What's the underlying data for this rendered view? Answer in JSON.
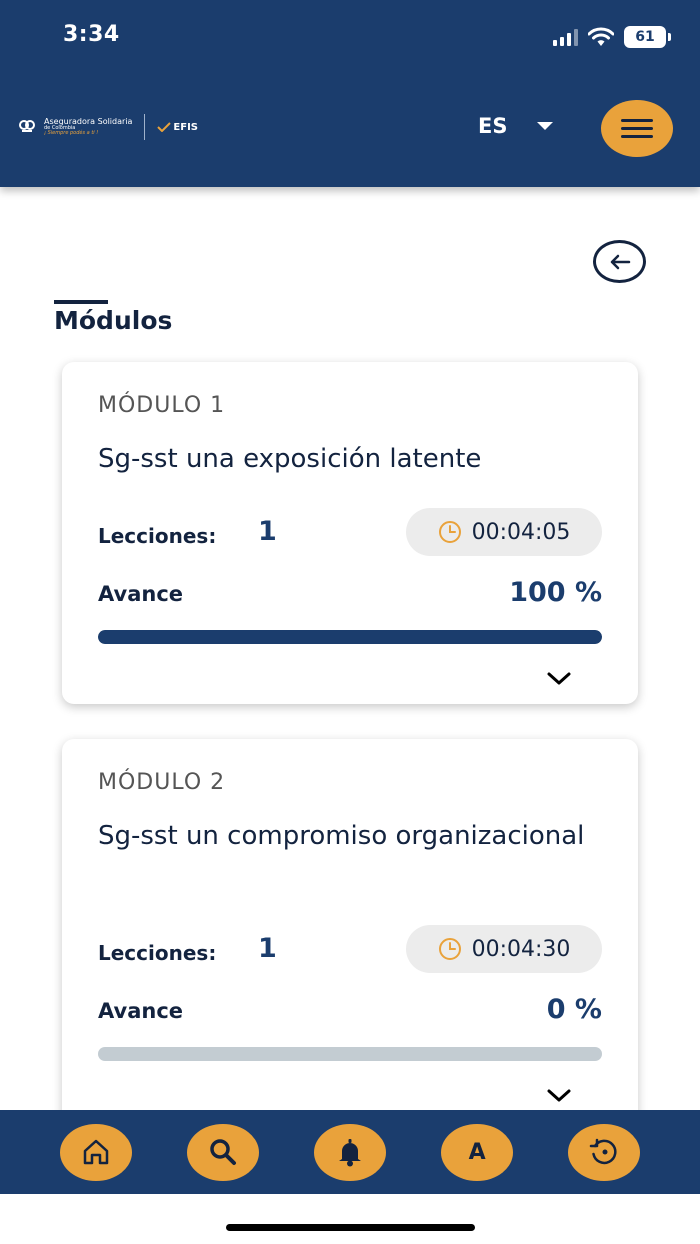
{
  "status_bar": {
    "time": "3:34",
    "battery": "61"
  },
  "header": {
    "logo": {
      "name": "Aseguradora Solidaria",
      "sub": "de Colombia",
      "slogan": "¡ Siempre podés a ti !",
      "partner": "EFIS"
    },
    "language": "ES"
  },
  "page_title": "Módulos",
  "modules": [
    {
      "label": "MÓDULO 1",
      "title": "Sg-sst una exposición latente",
      "lessons_label": "Lecciones:",
      "lessons": "1",
      "duration": "00:04:05",
      "progress_label": "Avance",
      "progress_text": "100 %",
      "progress": 1.0
    },
    {
      "label": "MÓDULO 2",
      "title": "Sg-sst un compromiso organizacional",
      "lessons_label": "Lecciones:",
      "lessons": "1",
      "duration": "00:04:30",
      "progress_label": "Avance",
      "progress_text": "0 %",
      "progress": 0.0
    }
  ],
  "bottom_nav": [
    {
      "icon": "home-icon"
    },
    {
      "icon": "search-icon"
    },
    {
      "icon": "bell-icon"
    },
    {
      "icon": "font-size-icon",
      "label": "A"
    },
    {
      "icon": "history-icon"
    }
  ],
  "colors": {
    "primary": "#1b3d6d",
    "accent": "#e9a23b",
    "track": "#c3ccd2",
    "text": "#13233f"
  }
}
